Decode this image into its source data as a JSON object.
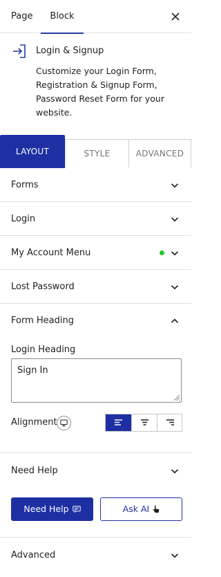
{
  "tabs": {
    "page": "Page",
    "block": "Block",
    "active": "block"
  },
  "block": {
    "title": "Login & Signup",
    "description": "Customize your Login Form, Registration & Signup Form, Password Reset Form for your website.",
    "icon": "login-enter-icon"
  },
  "section_tabs": {
    "layout": "LAYOUT",
    "style": "STYLE",
    "advanced": "ADVANCED",
    "active": "layout"
  },
  "panels": {
    "forms": "Forms",
    "login": "Login",
    "my_account_menu": "My Account Menu",
    "lost_password": "Lost Password",
    "form_heading": "Form Heading",
    "need_help": "Need Help",
    "advanced": "Advanced"
  },
  "my_account_menu_status_color": "#28c828",
  "form_heading": {
    "login_heading_label": "Login Heading",
    "login_heading_value": "Sign In",
    "alignment_label": "Alignment",
    "alignment_selected": "left",
    "alignment_options": [
      "left",
      "center",
      "right"
    ]
  },
  "need_help": {
    "help_button": "Need Help",
    "ai_button": "Ask AI"
  },
  "colors": {
    "accent": "#1e2fa3",
    "tab_underline": "#2739a6",
    "border": "#e0e0e0"
  }
}
